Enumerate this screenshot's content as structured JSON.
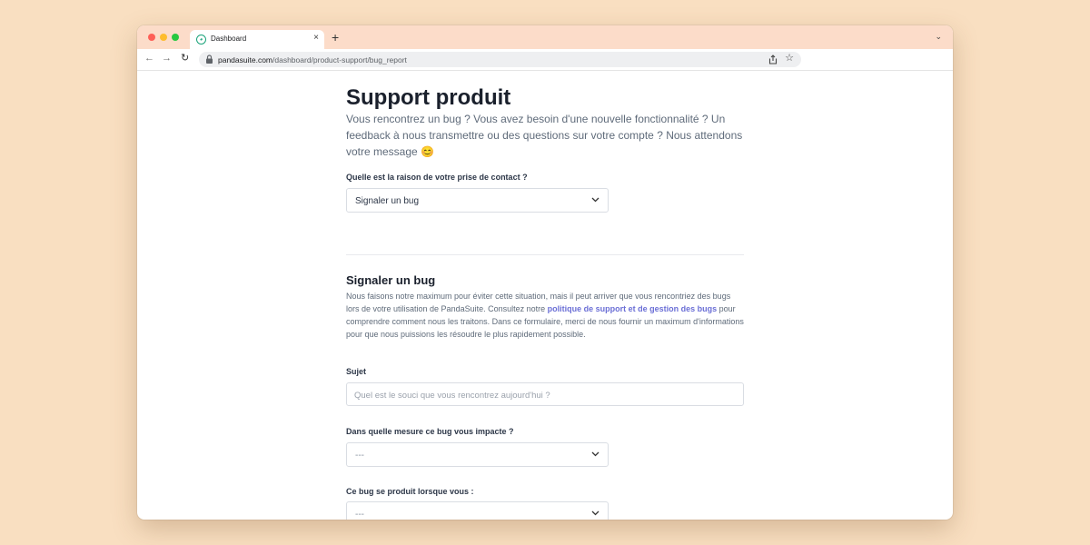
{
  "browser": {
    "tab_title": "Dashboard",
    "tab_close": "×",
    "new_tab": "+",
    "tab_menu": "⌄",
    "url_host": "pandasuite.com",
    "url_path": "/dashboard/product-support/bug_report",
    "nav_back": "←",
    "nav_forward": "→",
    "nav_reload": "↻",
    "star": "☆"
  },
  "page": {
    "title": "Support produit",
    "intro": "Vous rencontrez un bug ? Vous avez besoin d'une nouvelle fonctionnalité ? Un feedback à nous transmettre ou des questions sur votre compte ? Nous attendons votre message 😊",
    "reason_label": "Quelle est la raison de votre prise de contact ?",
    "reason_value": "Signaler un bug"
  },
  "bug_section": {
    "title": "Signaler un bug",
    "desc_before": "Nous faisons notre maximum pour éviter cette situation, mais il peut arriver que vous rencontriez des bugs lors de votre utilisation de PandaSuite. Consultez notre ",
    "desc_link": "politique de support et de gestion des bugs",
    "desc_after": " pour comprendre comment nous les traitons. Dans ce formulaire, merci de nous fournir un maximum d'informations pour que nous puissions les résoudre le plus rapidement possible.",
    "subject_label": "Sujet",
    "subject_placeholder": "Quel est le souci que vous rencontrez aujourd'hui ?",
    "impact_label": "Dans quelle mesure ce bug vous impacte ?",
    "impact_value": "---",
    "occurs_label": "Ce bug se produit lorsque vous :",
    "occurs_value": "---"
  },
  "colors": {
    "background": "#f9dfc1",
    "titlebar": "#fcdcc9",
    "link": "#6b6fd6"
  },
  "icons": [
    "close-icon",
    "plus-icon",
    "back-arrow-icon",
    "forward-arrow-icon",
    "reload-icon",
    "lock-icon",
    "share-icon",
    "star-icon",
    "chevron-down-icon"
  ]
}
